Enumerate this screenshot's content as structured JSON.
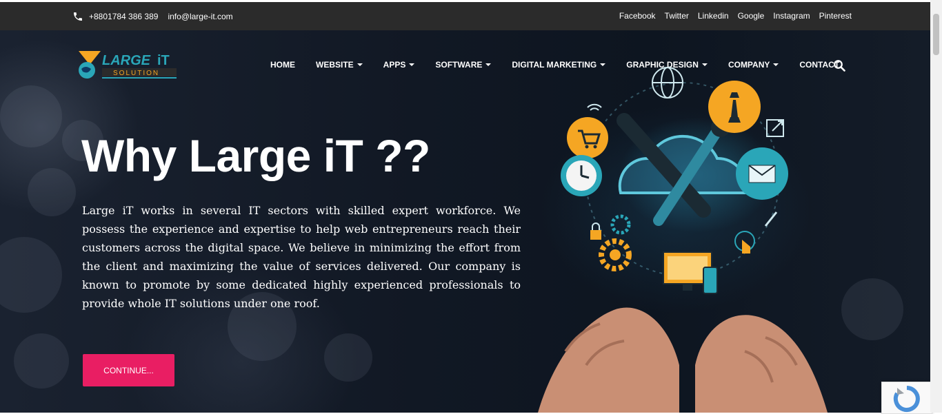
{
  "topbar": {
    "phone": "+8801784 386 389",
    "email": "info@large-it.com",
    "social": [
      "Facebook",
      "Twitter",
      "Linkedin",
      "Google",
      "Instagram",
      "Pinterest"
    ]
  },
  "logo": {
    "word1": "LARGE",
    "word2": "iT",
    "tagline": "SOLUTION"
  },
  "nav": {
    "home": "HOME",
    "website": "WEBSITE",
    "apps": "APPS",
    "software": "SOFTWARE",
    "digital_marketing": "DIGITAL MARKETING",
    "graphic_design": "GRAPHIC DESIGN",
    "company": "COMPANY",
    "contact": "CONTACT"
  },
  "hero": {
    "headline": "Why Large iT ??",
    "text": "Large iT works in several IT sectors with skilled expert workforce. We possess the experience and expertise to help web entrepreneurs reach their customers across the digital space. We believe in minimizing the effort from the client and maximizing the value of services delivered. Our company is known to promote by some dedicated highly experienced professionals to provide whole IT solutions under one roof.",
    "cta_label": "CONTINUE..."
  },
  "colors": {
    "topbar_bg": "#2b2b2b",
    "hero_bg": "#111824",
    "cta": "#e91e63",
    "accent_yellow": "#f5a623",
    "accent_teal": "#2aa6b8"
  },
  "icons": [
    "phone-icon",
    "search-icon",
    "caret-down-icon",
    "recaptcha-icon"
  ]
}
